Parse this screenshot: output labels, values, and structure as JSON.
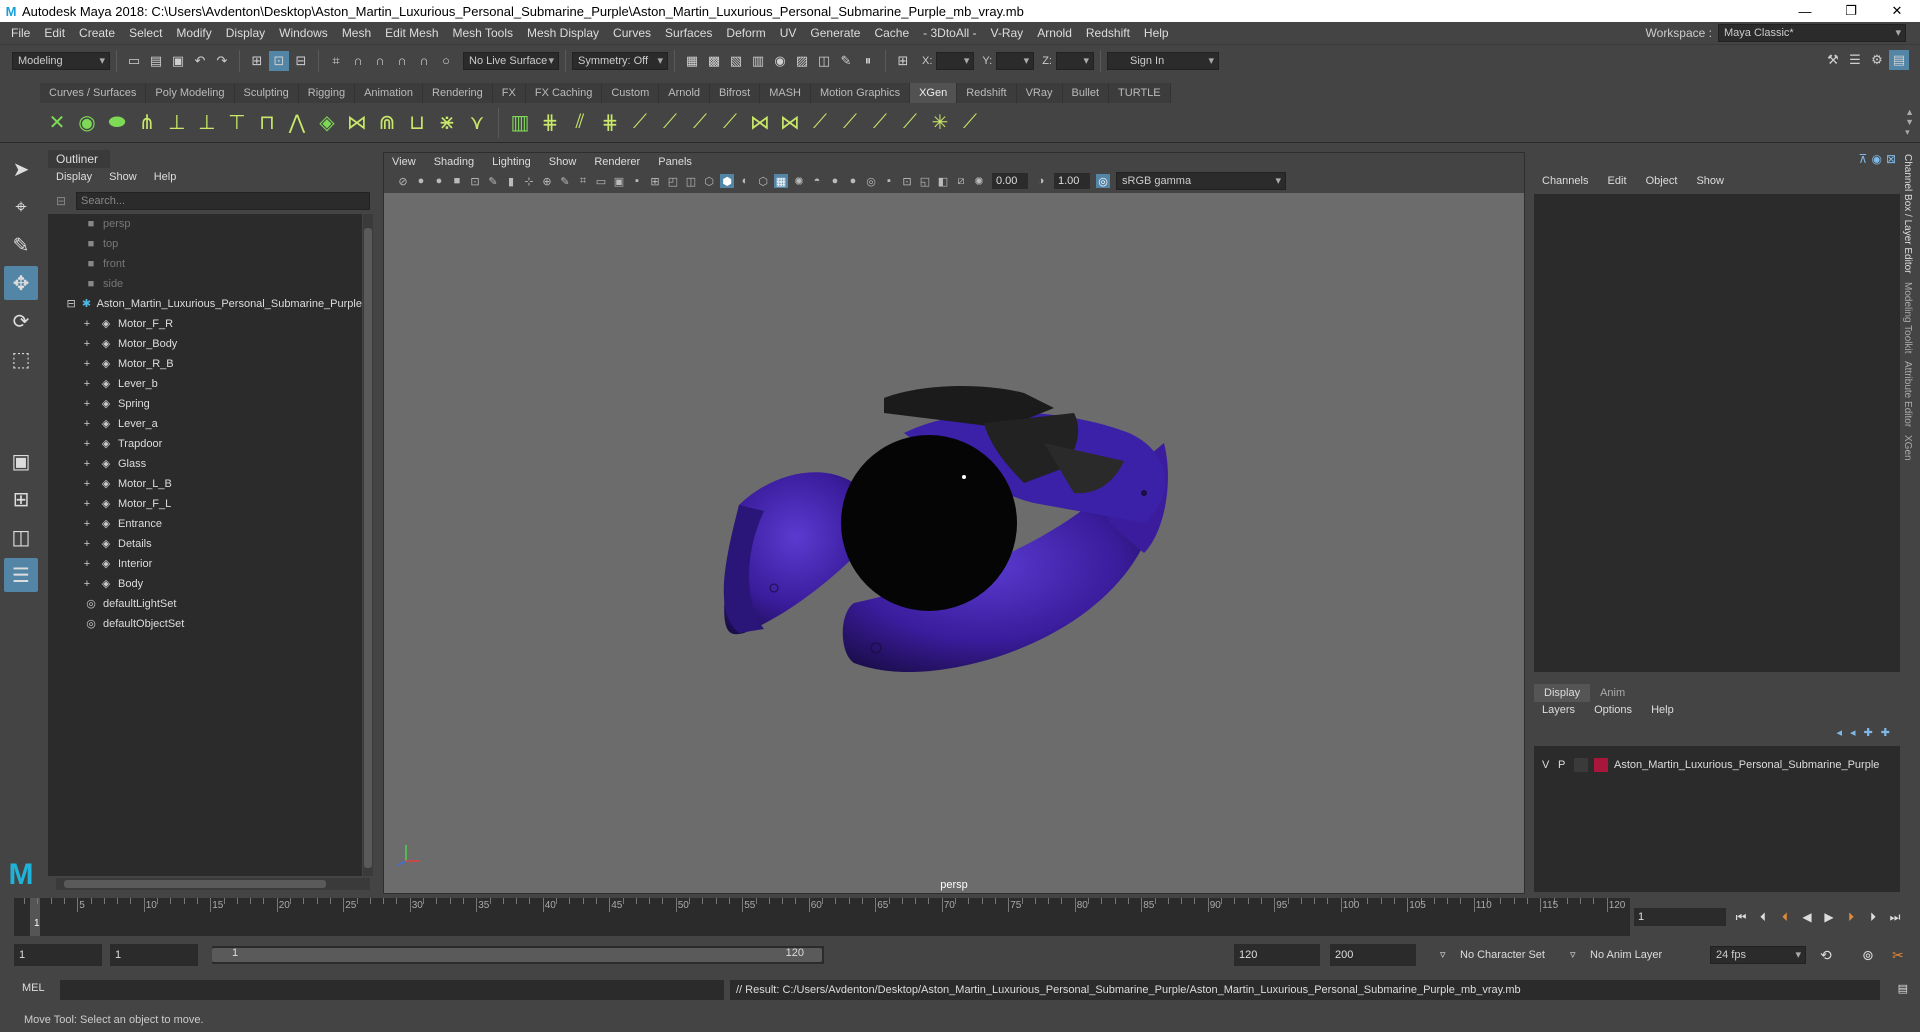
{
  "window": {
    "title": "Autodesk Maya 2018: C:\\Users\\Avdenton\\Desktop\\Aston_Martin_Luxurious_Personal_Submarine_Purple\\Aston_Martin_Luxurious_Personal_Submarine_Purple_mb_vray.mb"
  },
  "menubar": {
    "items": [
      "File",
      "Edit",
      "Create",
      "Select",
      "Modify",
      "Display",
      "Windows",
      "Mesh",
      "Edit Mesh",
      "Mesh Tools",
      "Mesh Display",
      "Curves",
      "Surfaces",
      "Deform",
      "UV",
      "Generate",
      "Cache",
      "- 3DtoAll -",
      "V-Ray",
      "Arnold",
      "Redshift",
      "Help"
    ]
  },
  "workspace": {
    "label": "Workspace :",
    "value": "Maya Classic*"
  },
  "statusline": {
    "mode": "Modeling",
    "live_surface": "No Live Surface",
    "symmetry": "Symmetry: Off",
    "x_label": "X:",
    "y_label": "Y:",
    "z_label": "Z:",
    "sign_in": "Sign In"
  },
  "shelf_tabs": [
    "Curves / Surfaces",
    "Poly Modeling",
    "Sculpting",
    "Rigging",
    "Animation",
    "Rendering",
    "FX",
    "FX Caching",
    "Custom",
    "Arnold",
    "Bifrost",
    "MASH",
    "Motion Graphics",
    "XGen",
    "Redshift",
    "VRay",
    "Bullet",
    "TURTLE"
  ],
  "shelf_active": "XGen",
  "outliner": {
    "title": "Outliner",
    "menu": [
      "Display",
      "Show",
      "Help"
    ],
    "search_placeholder": "Search...",
    "cameras": [
      "persp",
      "top",
      "front",
      "side"
    ],
    "group": "Aston_Martin_Luxurious_Personal_Submarine_Purple",
    "children": [
      "Motor_F_R",
      "Motor_Body",
      "Motor_R_B",
      "Lever_b",
      "Spring",
      "Lever_a",
      "Trapdoor",
      "Glass",
      "Motor_L_B",
      "Motor_F_L",
      "Entrance",
      "Details",
      "Interior",
      "Body"
    ],
    "sets": [
      "defaultLightSet",
      "defaultObjectSet"
    ]
  },
  "viewport": {
    "menu": [
      "View",
      "Shading",
      "Lighting",
      "Show",
      "Renderer",
      "Panels"
    ],
    "exposure": "0.00",
    "gamma": "1.00",
    "color_space": "sRGB gamma",
    "camera": "persp"
  },
  "channelbox": {
    "menu": [
      "Channels",
      "Edit",
      "Object",
      "Show"
    ]
  },
  "layers": {
    "tabs": [
      "Display",
      "Anim"
    ],
    "active_tab": "Display",
    "menu": [
      "Layers",
      "Options",
      "Help"
    ],
    "layer": {
      "v": "V",
      "p": "P",
      "name": "Aston_Martin_Luxurious_Personal_Submarine_Purple",
      "color": "#a9163b"
    }
  },
  "side_tabs": [
    "Channel Box / Layer Editor",
    "Modeling Toolkit",
    "Attribute Editor",
    "XGen"
  ],
  "timeslider": {
    "ticks": [
      "5",
      "10",
      "15",
      "20",
      "25",
      "30",
      "35",
      "40",
      "45",
      "50",
      "55",
      "60",
      "65",
      "70",
      "75",
      "80",
      "85",
      "90",
      "95",
      "100",
      "105",
      "110",
      "115",
      "120"
    ],
    "current": "1",
    "frame_field": "1"
  },
  "range": {
    "start": "1",
    "inner_start": "1",
    "bar_start": "1",
    "bar_end": "120",
    "end": "120",
    "max": "200",
    "character_set": "No Character Set",
    "anim_layer": "No Anim Layer",
    "fps": "24 fps"
  },
  "cmdline": {
    "lang": "MEL",
    "result": "// Result: C:/Users/Avdenton/Desktop/Aston_Martin_Luxurious_Personal_Submarine_Purple/Aston_Martin_Luxurious_Personal_Submarine_Purple_mb_vray.mb"
  },
  "helpline": "Move Tool: Select an object to move.",
  "colors": {
    "accent": "#5285a6",
    "model_purple": "#3a1c9c",
    "layer_red": "#a9163b"
  }
}
